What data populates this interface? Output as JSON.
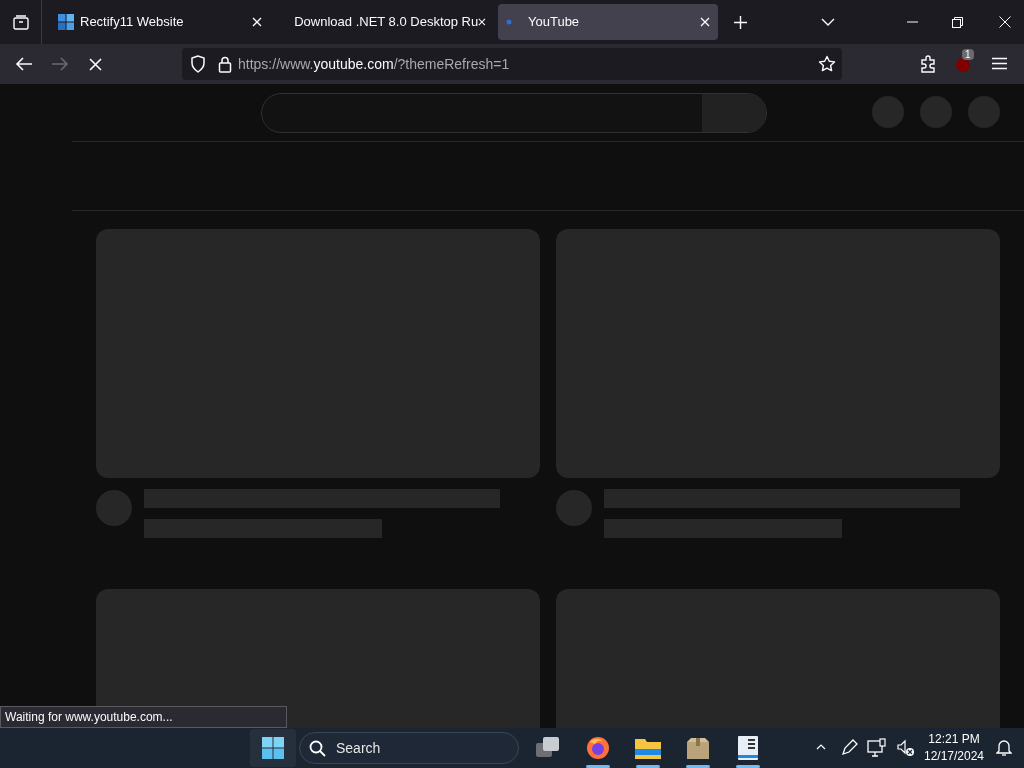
{
  "tabs": [
    {
      "label": "Rectify11 Website",
      "kind": "windows",
      "selected": false
    },
    {
      "label": "Download .NET 8.0 Desktop Ru",
      "kind": "none",
      "selected": false
    },
    {
      "label": "YouTube",
      "kind": "loading",
      "selected": true
    }
  ],
  "address_bar": {
    "url": "https://www.**youtube.com**/?themeRefresh=1"
  },
  "extension_badge": "1",
  "status_text": "Waiting for www.youtube.com...",
  "taskbar": {
    "search": {
      "placeholder": "Search"
    },
    "apps": [
      {
        "kind": "taskview",
        "running": false
      },
      {
        "kind": "firefox",
        "running": true
      },
      {
        "kind": "explorer",
        "running": true
      },
      {
        "kind": "box",
        "running": true
      },
      {
        "kind": "doc",
        "running": true
      }
    ],
    "time": "12:21 PM",
    "date": "12/17/2024"
  }
}
